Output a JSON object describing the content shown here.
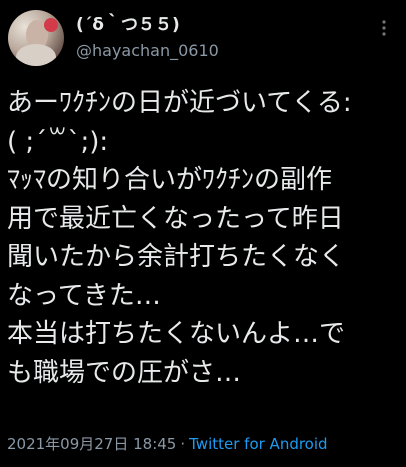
{
  "author": {
    "display_name": "(´δ｀つ５５)",
    "handle": "@hayachan_0610"
  },
  "tweet": {
    "lines": [
      "あーﾜｸﾁﾝの日が近づいてくる:",
      "( ;´꒳`;):",
      "ﾏｯﾏの知り合いがﾜｸﾁﾝの副作",
      "用で最近亡くなったって昨日",
      "聞いたから余計打ちたくなく",
      "なってきた…",
      "本当は打ちたくないんよ…で",
      "も職場での圧がさ…"
    ]
  },
  "meta": {
    "timestamp": "2021年09月27日 18:45",
    "separator": "·",
    "source": "Twitter for Android"
  },
  "icons": {
    "more": "more-options-icon"
  },
  "colors": {
    "background": "#000000",
    "text": "#e7e9ea",
    "secondary": "#8b98a5",
    "link": "#1d9bf0"
  }
}
